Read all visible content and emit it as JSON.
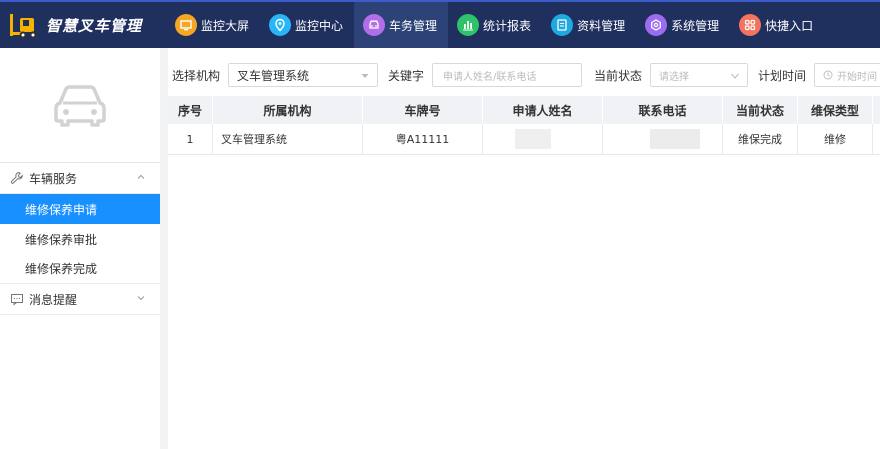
{
  "app": {
    "title": "智慧叉车管理"
  },
  "nav": [
    {
      "label": "监控大屏",
      "icon": "monitor-icon",
      "color": "#f5a623",
      "active": false
    },
    {
      "label": "监控中心",
      "icon": "location-pin-icon",
      "color": "#29b6f6",
      "active": false
    },
    {
      "label": "车务管理",
      "icon": "car-icon",
      "color": "#b06ee8",
      "active": true
    },
    {
      "label": "统计报表",
      "icon": "bar-chart-icon",
      "color": "#2ec26b",
      "active": false
    },
    {
      "label": "资料管理",
      "icon": "document-icon",
      "color": "#1fa9e1",
      "active": false
    },
    {
      "label": "系统管理",
      "icon": "gear-icon",
      "color": "#9b6cf0",
      "active": false
    },
    {
      "label": "快捷入口",
      "icon": "grid-icon",
      "color": "#f4735f",
      "active": false
    }
  ],
  "sidebar": {
    "groups": [
      {
        "label": "车辆服务",
        "icon": "wrench-icon",
        "expanded": true,
        "items": [
          {
            "label": "维修保养申请",
            "active": true
          },
          {
            "label": "维修保养审批",
            "active": false
          },
          {
            "label": "维修保养完成",
            "active": false
          }
        ]
      },
      {
        "label": "消息提醒",
        "icon": "message-icon",
        "expanded": false,
        "items": []
      }
    ]
  },
  "filter": {
    "org_label": "选择机构",
    "org_value": "叉车管理系统",
    "keyword_label": "关键字",
    "keyword_placeholder": "申请人姓名/联系电话",
    "status_label": "当前状态",
    "status_placeholder": "请选择",
    "time_label": "计划时间",
    "time_placeholder": "开始时间"
  },
  "table": {
    "columns": [
      "序号",
      "所属机构",
      "车牌号",
      "申请人姓名",
      "联系电话",
      "当前状态",
      "维保类型"
    ],
    "rows": [
      {
        "index": "1",
        "org": "叉车管理系统",
        "plate": "粤A11111",
        "applicant": "",
        "phone": "",
        "status": "维保完成",
        "type": "维修"
      }
    ]
  },
  "colors": {
    "topbar": "#1f2f5e",
    "active_menu": "#1890ff"
  }
}
